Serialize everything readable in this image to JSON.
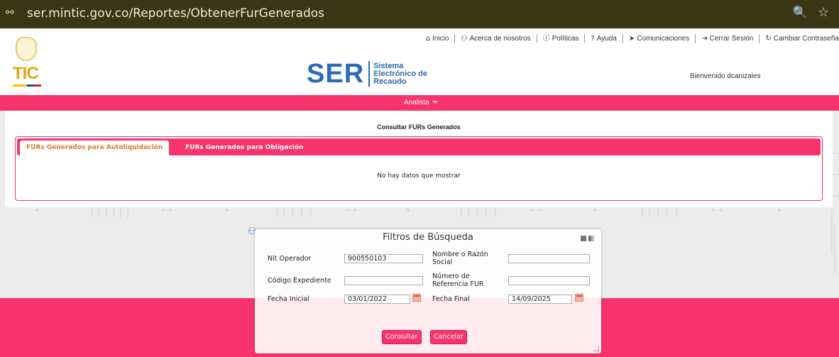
{
  "browser": {
    "url": "ser.mintic.gov.co/Reportes/ObtenerFurGenerados",
    "tune_icon": "⚯",
    "zoom_icon": "🔍",
    "star_icon": "☆"
  },
  "header": {
    "links": [
      {
        "icon": "⌂",
        "label": "Inicio"
      },
      {
        "icon": "⚇",
        "label": "Acerca de nosotros"
      },
      {
        "icon": "ⓘ",
        "label": "Políticas"
      },
      {
        "icon": "?",
        "label": "Ayuda"
      },
      {
        "icon": "➤",
        "label": "Comunicaciones"
      },
      {
        "icon": "⇥",
        "label": "Cerrar Sesión"
      },
      {
        "icon": "↻",
        "label": "Cambiar Contraseña"
      }
    ],
    "tic_text": "TIC",
    "ser_text": "SER",
    "ser_subtitle": "Sistema Electrónico de Recaudo",
    "welcome": "Bienvenido dcanizales"
  },
  "menu": {
    "role": "Analista"
  },
  "panel": {
    "title": "Consultar FURs Generados",
    "tabs": [
      {
        "label": "FURs Generados para Autoliquidación",
        "active": true
      },
      {
        "label": "FURs Generados para Obligación",
        "active": false
      }
    ],
    "empty_message": "No hay datos que mostrar"
  },
  "dialog": {
    "title": "Filtros de Búsqueda",
    "fields": {
      "nit_label": "Nit Operador",
      "nit_value": "900550103",
      "razon_label": "Nombre o Razón Social",
      "razon_value": "",
      "codigo_label": "Código Expediente",
      "codigo_value": "",
      "referencia_label": "Número de Referencia FUR",
      "referencia_value": "",
      "fecha_inicial_label": "Fecha Inicial",
      "fecha_inicial_value": "03/01/2022",
      "fecha_final_label": "Fecha Final",
      "fecha_final_value": "14/09/2025"
    },
    "consultar": "Consultar",
    "cancelar": "Cancelar"
  },
  "colors": {
    "brand_pink": "#f9336b",
    "ser_blue": "#2a6ab7",
    "active_tab_text": "#e0782a"
  }
}
